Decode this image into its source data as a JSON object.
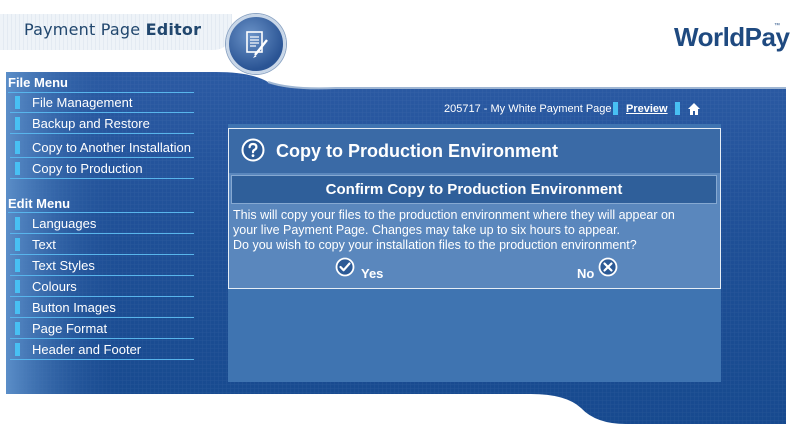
{
  "header": {
    "app_title_regular": "Payment Page",
    "app_title_bold": "Editor",
    "brand": "WorldPay",
    "brand_tm": "™"
  },
  "icons": {
    "editor_badge": "document-pencil-icon",
    "home": "home-icon",
    "help": "question-icon",
    "yes": "checkmark-icon",
    "no": "x-icon"
  },
  "colors": {
    "accent": "#48c0f3",
    "panel": "#3f74b1",
    "dialog_header": "#3a6aa6",
    "brand": "#1f4a80"
  },
  "sidebar": {
    "file_menu": {
      "heading": "File Menu",
      "items": [
        {
          "label": "File Management"
        },
        {
          "label": "Backup and Restore"
        },
        {
          "label": "Copy to Another Installation"
        },
        {
          "label": "Copy to Production"
        }
      ]
    },
    "edit_menu": {
      "heading": "Edit Menu",
      "items": [
        {
          "label": "Languages"
        },
        {
          "label": "Text"
        },
        {
          "label": "Text Styles"
        },
        {
          "label": "Colours"
        },
        {
          "label": "Button Images"
        },
        {
          "label": "Page Format"
        },
        {
          "label": "Header and Footer"
        }
      ]
    }
  },
  "toolbar": {
    "installation": "205717 - My White Payment Page",
    "preview_label": "Preview"
  },
  "dialog": {
    "title": "Copy to Production Environment",
    "subtitle": "Confirm Copy to Production Environment",
    "body_lines": [
      "This will copy your files to the production environment where they will appear on",
      "your live Payment Page. Changes may take up to six hours to appear.",
      "Do you wish to copy your installation files to the production environment?"
    ],
    "yes_label": "Yes",
    "no_label": "No"
  }
}
